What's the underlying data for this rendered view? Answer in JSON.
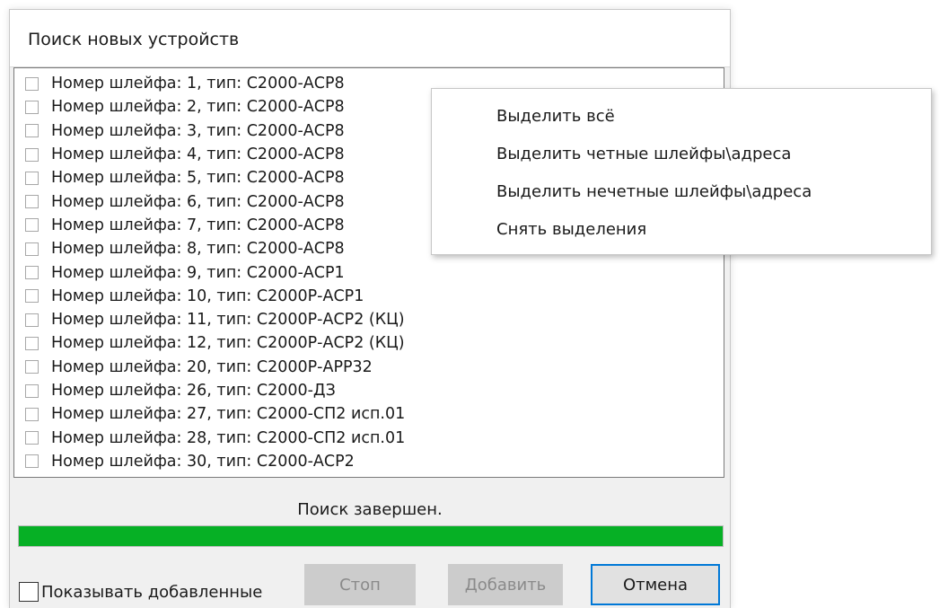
{
  "dialog": {
    "title": "Поиск новых устройств"
  },
  "list": {
    "items": [
      {
        "label": "Номер шлейфа: 1, тип: С2000-АСР8",
        "checked": false
      },
      {
        "label": "Номер шлейфа: 2, тип: С2000-АСР8",
        "checked": false
      },
      {
        "label": "Номер шлейфа: 3, тип: С2000-АСР8",
        "checked": false
      },
      {
        "label": "Номер шлейфа: 4, тип: С2000-АСР8",
        "checked": false
      },
      {
        "label": "Номер шлейфа: 5, тип: С2000-АСР8",
        "checked": false
      },
      {
        "label": "Номер шлейфа: 6, тип: С2000-АСР8",
        "checked": false
      },
      {
        "label": "Номер шлейфа: 7, тип: С2000-АСР8",
        "checked": false
      },
      {
        "label": "Номер шлейфа: 8, тип: С2000-АСР8",
        "checked": false
      },
      {
        "label": "Номер шлейфа: 9, тип: С2000-АСР1",
        "checked": false
      },
      {
        "label": "Номер шлейфа: 10, тип: С2000Р-АСР1",
        "checked": false
      },
      {
        "label": "Номер шлейфа: 11, тип: С2000Р-АСР2 (КЦ)",
        "checked": false
      },
      {
        "label": "Номер шлейфа: 12, тип: С2000Р-АСР2 (КЦ)",
        "checked": false
      },
      {
        "label": "Номер шлейфа: 20, тип: С2000Р-АРР32",
        "checked": false
      },
      {
        "label": "Номер шлейфа: 26, тип: С2000-ДЗ",
        "checked": false
      },
      {
        "label": "Номер шлейфа: 27, тип: С2000-СП2 исп.01",
        "checked": false
      },
      {
        "label": "Номер шлейфа: 28, тип: С2000-СП2 исп.01",
        "checked": false
      },
      {
        "label": "Номер шлейфа: 30, тип: С2000-АСР2",
        "checked": false
      }
    ]
  },
  "status": {
    "text": "Поиск завершен.",
    "progress_percent": 100,
    "progress_color": "#06b025"
  },
  "footer": {
    "show_added_label": "Показывать добавленные",
    "show_added_checked": false,
    "stop_label": "Стоп",
    "stop_enabled": false,
    "add_label": "Добавить",
    "add_enabled": false,
    "cancel_label": "Отмена",
    "cancel_enabled": true,
    "accent_color": "#0078d7"
  },
  "context_menu": {
    "items": [
      {
        "label": "Выделить всё"
      },
      {
        "label": "Выделить четные шлейфы\\адреса"
      },
      {
        "label": "Выделить нечетные шлейфы\\адреса"
      },
      {
        "label": "Снять выделения"
      }
    ]
  }
}
